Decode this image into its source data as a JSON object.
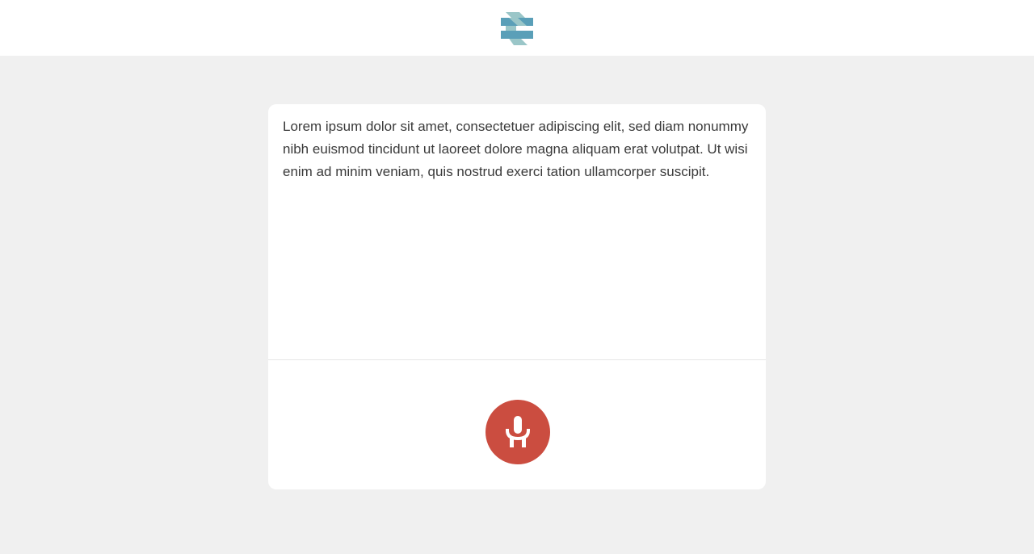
{
  "header": {
    "logo_icon": "brand-logo-icon",
    "logo_colors": [
      "#5a9fb8",
      "#9ac6c8"
    ]
  },
  "editor": {
    "text": "Lorem ipsum dolor sit amet, consectetuer adipiscing elit, sed diam nonummy nibh euismod tincidunt ut laoreet dolore magna aliquam erat volutpat. Ut wisi enim ad minim veniam, quis nostrud exerci tation ullamcorper suscipit."
  },
  "controls": {
    "mic_icon": "microphone-icon",
    "mic_color": "#cb4d40"
  },
  "colors": {
    "background": "#f0f0f0",
    "card": "#ffffff",
    "text": "#3a3a3a"
  }
}
